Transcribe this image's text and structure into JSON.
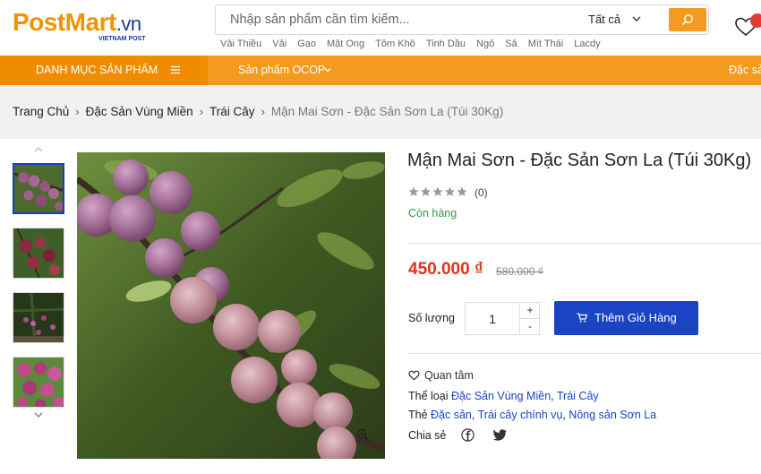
{
  "header": {
    "logo_main": "PostMart",
    "logo_suffix": ".vn",
    "logo_tagline": "VIETNAM POST",
    "search_placeholder": "Nhập sản phẩm cần tìm kiếm...",
    "search_category": "Tất cả",
    "quick_links": [
      "Vải Thiều",
      "Vải",
      "Gạo",
      "Mật Ong",
      "Tôm Khô",
      "Tinh Dầu",
      "Ngô",
      "Sả",
      "Mít Thái",
      "Lacdy"
    ]
  },
  "nav": {
    "category_label": "DANH MỤC SẢN PHẨM",
    "ocop_label": "Sản phẩm OCOP",
    "dacsan_label": "Đặc sả"
  },
  "breadcrumb": {
    "items": [
      "Trang Chủ",
      "Đặc Sản Vùng Miền",
      "Trái Cây"
    ],
    "current": "Mận Mai Sơn - Đặc Sản Sơn La (Túi 30Kg)"
  },
  "product": {
    "title": "Mận Mai Sơn - Đặc Sản Sơn La (Túi 30Kg)",
    "rating": 0,
    "review_count": "(0)",
    "stock": "Còn hàng",
    "price": "450.000 ₫",
    "old_price": "580.000 ₫",
    "qty_label": "Số lượng",
    "qty_value": "1",
    "qty_plus": "+",
    "qty_minus": "-",
    "add_to_cart": "Thêm Giỏ Hàng",
    "favorite": "Quan tâm",
    "category_label": "Thể loại",
    "categories": [
      "Đặc Sản Vùng Miền",
      "Trái Cây"
    ],
    "tag_label": "Thẻ",
    "tags": [
      "Đặc sản",
      "Trái cây chính vụ",
      "Nông sản Sơn La"
    ],
    "share_label": "Chia sẻ"
  },
  "colors": {
    "brand_orange": "#f39a1f",
    "brand_blue": "#1a44c4",
    "price_red": "#e1321b",
    "stock_green": "#2e9a4b"
  }
}
